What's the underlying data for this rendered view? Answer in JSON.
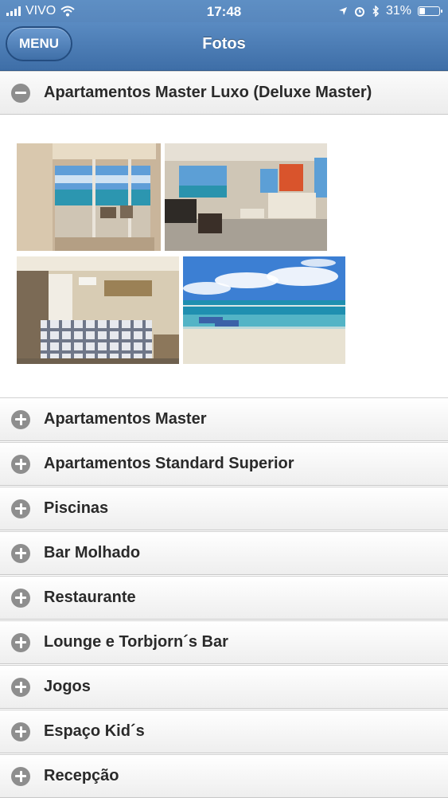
{
  "status": {
    "carrier": "VIVO",
    "time": "17:48",
    "battery": "31%",
    "battery_level": 0.31
  },
  "nav": {
    "menu_label": "MENU",
    "title": "Fotos"
  },
  "expanded_section": {
    "label": "Apartamentos Master Luxo (Deluxe Master)"
  },
  "sections": [
    {
      "label": "Apartamentos Master"
    },
    {
      "label": "Apartamentos Standard Superior"
    },
    {
      "label": "Piscinas"
    },
    {
      "label": "Bar Molhado"
    },
    {
      "label": "Restaurante"
    },
    {
      "label": "Lounge e Torbjorn´s Bar"
    },
    {
      "label": "Jogos"
    },
    {
      "label": "Espaço Kid´s"
    },
    {
      "label": "Recepção"
    }
  ]
}
